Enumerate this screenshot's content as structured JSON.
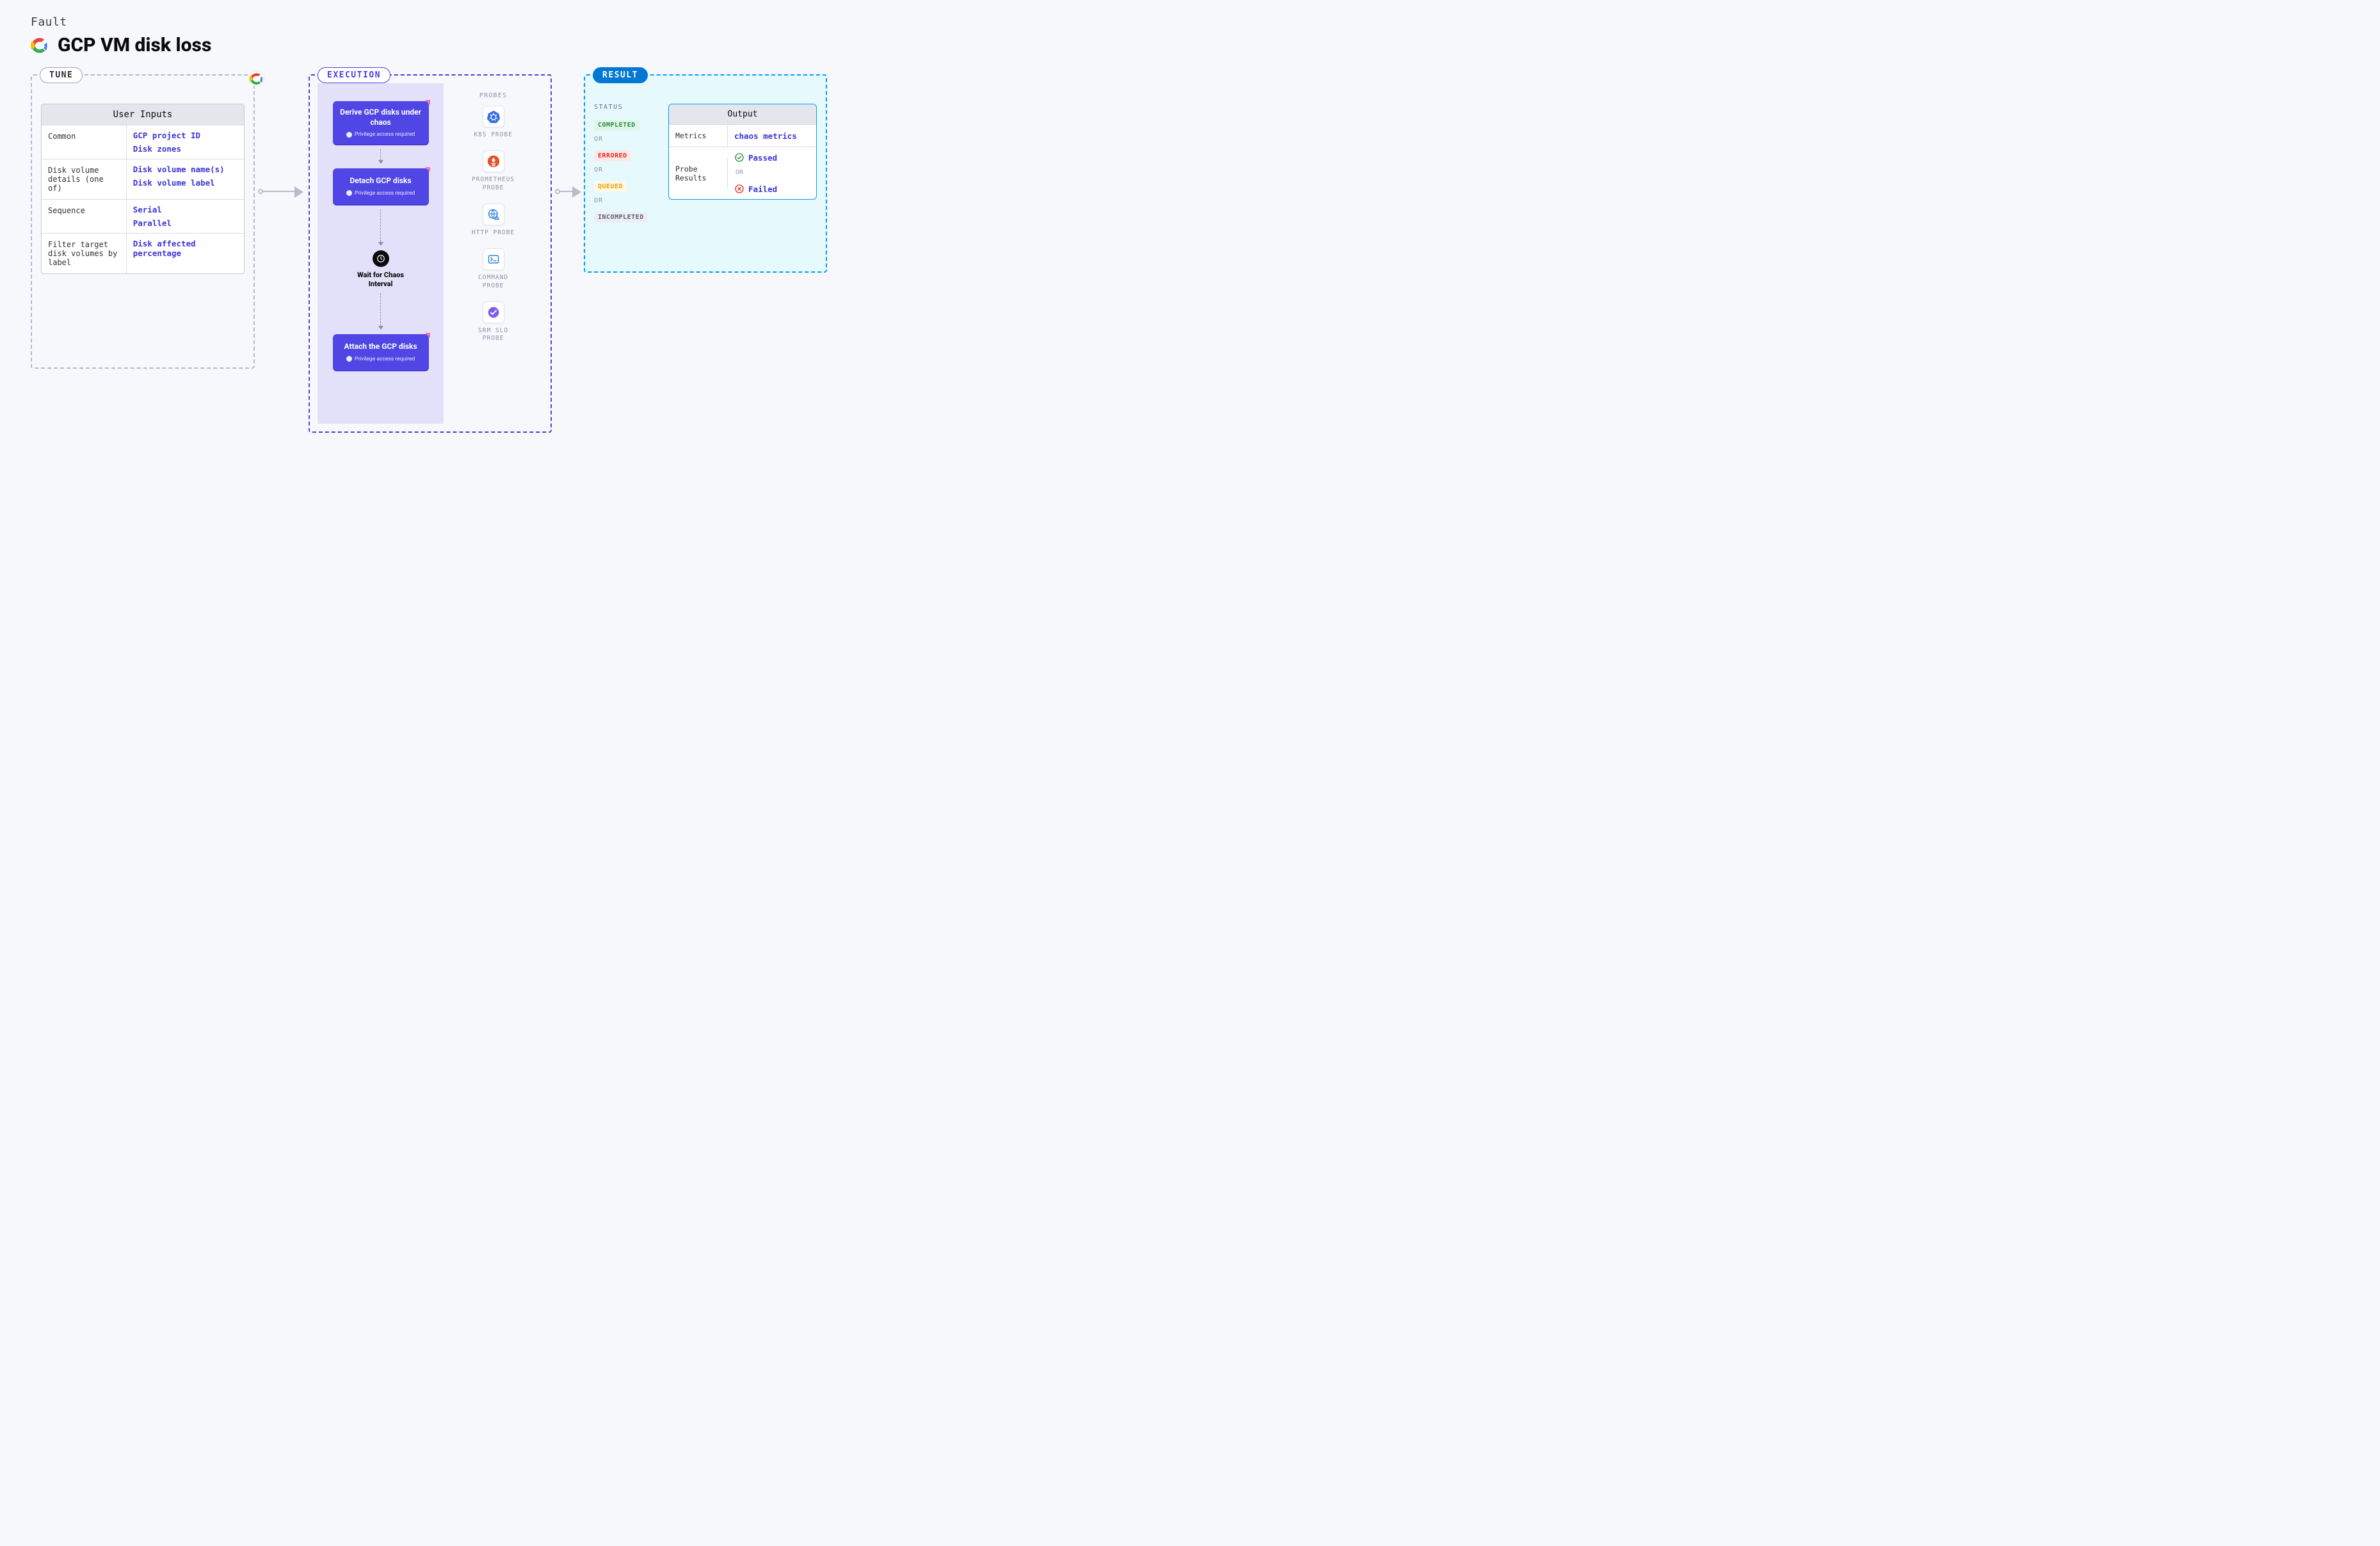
{
  "header": {
    "eyebrow": "Fault",
    "title": "GCP VM disk loss"
  },
  "tune": {
    "pill": "TUNE",
    "table_title": "User Inputs",
    "rows": [
      {
        "k": "Common",
        "v": [
          "GCP project ID",
          "Disk zones"
        ]
      },
      {
        "k": "Disk volume details (one of)",
        "v": [
          "Disk volume name(s)",
          "Disk volume label"
        ]
      },
      {
        "k": "Sequence",
        "v": [
          "Serial",
          "Parallel"
        ]
      },
      {
        "k": "Filter target disk volumes by label",
        "v": [
          "Disk affected percentage"
        ]
      }
    ]
  },
  "execution": {
    "pill": "EXECUTION",
    "privilege_note": "Privilege access required",
    "steps": {
      "a": "Derive GCP disks under chaos",
      "b": "Detach GCP disks",
      "wait": "Wait for Chaos Interval",
      "c": "Attach the GCP disks"
    },
    "probes": {
      "header": "PROBES",
      "items": [
        {
          "name": "k8s",
          "label": "K8S PROBE"
        },
        {
          "name": "prometheus",
          "label": "PROMETHEUS\nPROBE"
        },
        {
          "name": "http",
          "label": "HTTP PROBE"
        },
        {
          "name": "command",
          "label": "COMMAND\nPROBE"
        },
        {
          "name": "srmslo",
          "label": "SRM SLO\nPROBE"
        }
      ]
    }
  },
  "result": {
    "pill": "RESULT",
    "status_header": "STATUS",
    "or": "OR",
    "statuses": [
      "COMPLETED",
      "ERRORED",
      "QUEUED",
      "INCOMPLETED"
    ],
    "output": {
      "title": "Output",
      "metrics_k": "Metrics",
      "metrics_v": "chaos metrics",
      "probe_k": "Probe Results",
      "passed": "Passed",
      "failed": "Failed"
    }
  }
}
